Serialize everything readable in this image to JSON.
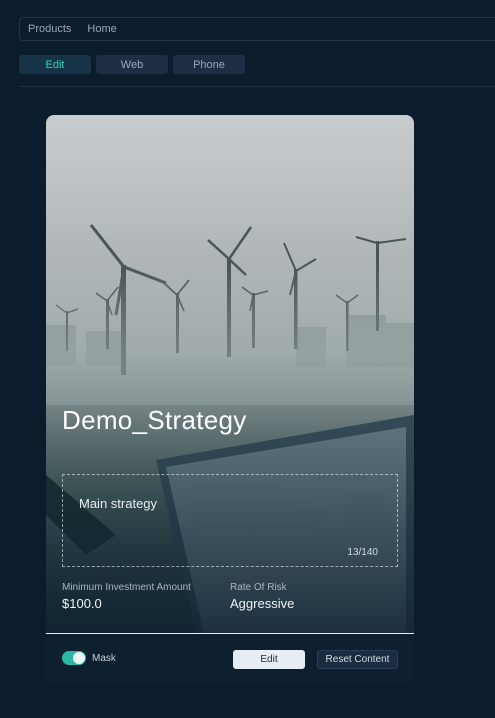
{
  "breadcrumb": {
    "items": [
      "Products",
      "Home"
    ]
  },
  "tabs": [
    {
      "label": "Edit",
      "active": true
    },
    {
      "label": "Web",
      "active": false
    },
    {
      "label": "Phone",
      "active": false
    }
  ],
  "card": {
    "hero_image": "wind-turbines-fog-tablet-photo",
    "title": "Demo_Strategy",
    "description": "Main strategy",
    "char_count": "13/140",
    "stats": [
      {
        "label": "Minimum Investment Amount",
        "value": "$100.0"
      },
      {
        "label": "Rate Of Risk",
        "value": "Aggressive"
      }
    ]
  },
  "footer": {
    "mask_label": "Mask",
    "mask_enabled": true,
    "edit_label": "Edit",
    "reset_label": "Reset Content"
  },
  "colors": {
    "background": "#0b1c2d",
    "accent": "#2bb7a3",
    "active_tab_text": "#2fd3b6"
  }
}
